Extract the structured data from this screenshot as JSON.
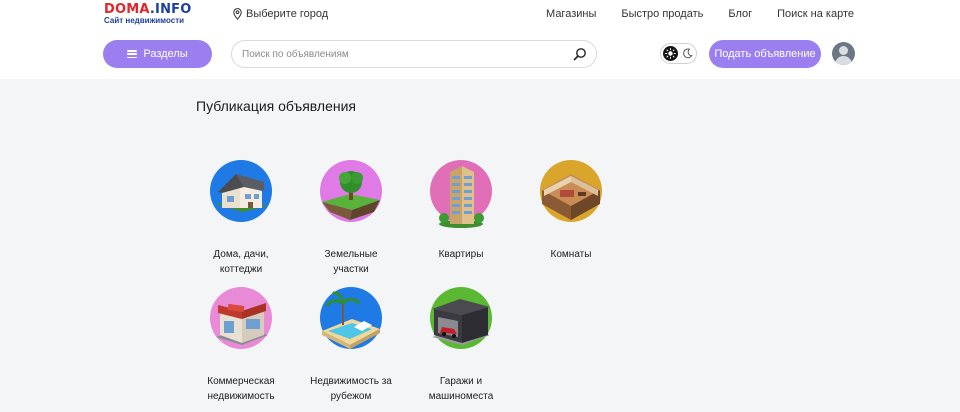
{
  "logo": {
    "main_left": "DOMA",
    "main_dot": ".",
    "main_right": "INFO",
    "subtitle": "Сайт недвижимости"
  },
  "header": {
    "city_label": "Выберите город",
    "nav": [
      "Магазины",
      "Быстро продать",
      "Блог",
      "Поиск на карте"
    ],
    "sections_label": "Разделы",
    "search_placeholder": "Поиск по объявлениям",
    "post_label": "Подать объявление"
  },
  "main": {
    "title": "Публикация объявления",
    "categories": [
      {
        "label": "Дома, дачи, коттеджи",
        "icon": "house-icon",
        "color": "#1f7ae6"
      },
      {
        "label": "Земельные участки",
        "icon": "land-plot-icon",
        "color": "#e07ae6"
      },
      {
        "label": "Квартиры",
        "icon": "apartment-building-icon",
        "color": "#e06fb8"
      },
      {
        "label": "Комнаты",
        "icon": "room-icon",
        "color": "#d9a52b"
      },
      {
        "label": "Коммерческая недвижимость",
        "icon": "shop-icon",
        "color": "#e88ad6"
      },
      {
        "label": "Недвижимость за рубежом",
        "icon": "island-icon",
        "color": "#1f7ae6"
      },
      {
        "label": "Гаражи и машиноместа",
        "icon": "garage-icon",
        "color": "#5bb833"
      }
    ]
  }
}
